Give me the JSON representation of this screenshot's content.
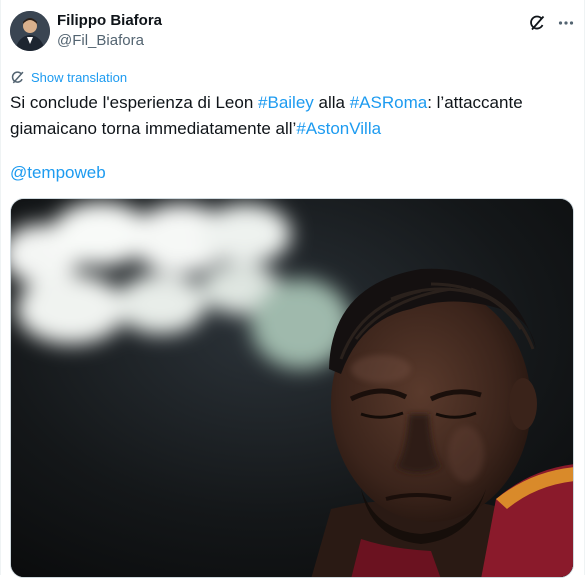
{
  "author": {
    "name": "Filippo Biafora",
    "handle": "@Fil_Biafora"
  },
  "icons": {
    "grok": "grok-icon",
    "more": "more-icon",
    "translate": "translate-icon"
  },
  "translation": {
    "label": "Show translation"
  },
  "tweet": {
    "part1": "Si conclude l'esperienza di Leon ",
    "tag1": "#Bailey",
    "part2": " alla ",
    "tag2": "#ASRoma",
    "part3": ": l’attaccante",
    "part4": "giamaicano torna immediatamente all’",
    "tag3": "#AstonVilla",
    "mention": "@tempoweb"
  },
  "colors": {
    "link": "#1d9bf0",
    "text": "#0f1419",
    "secondary": "#536471",
    "jersey": "#8a1a2b"
  }
}
